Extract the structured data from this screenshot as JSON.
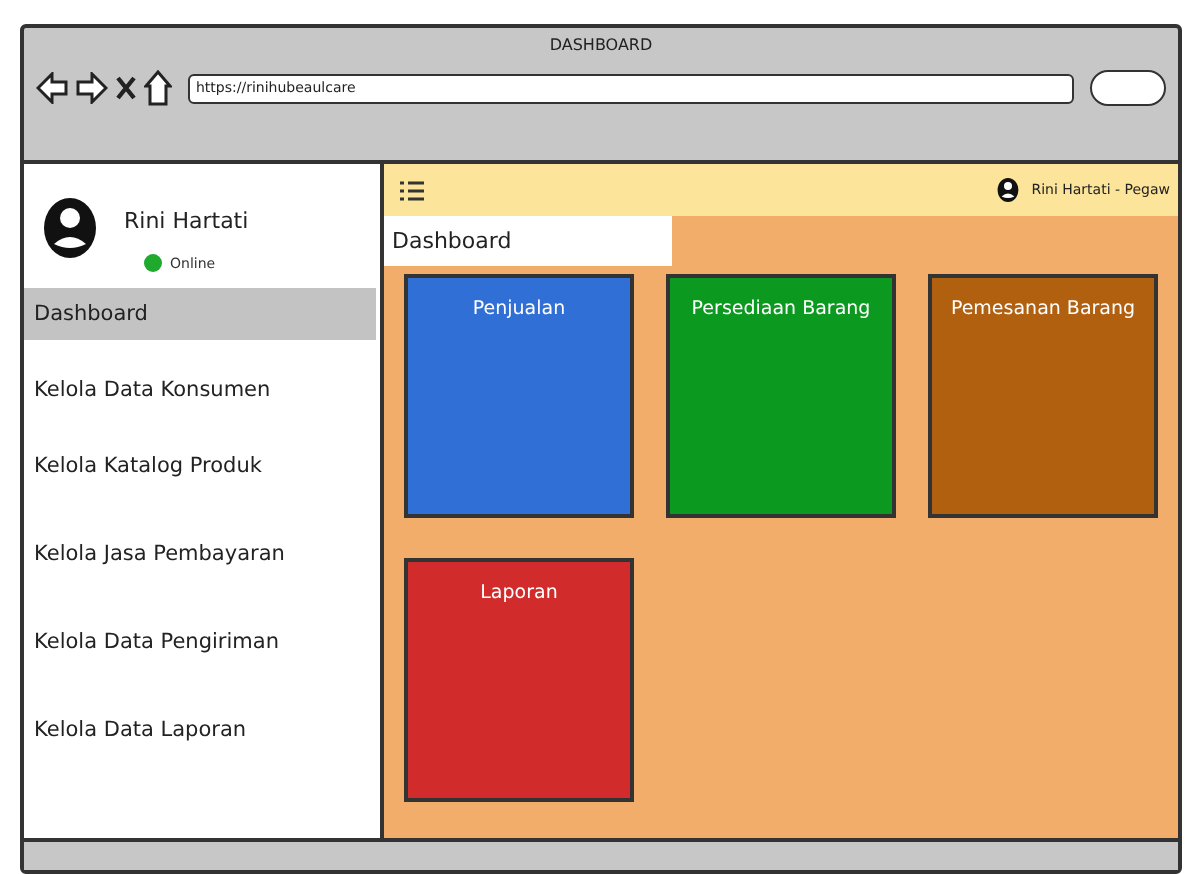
{
  "window": {
    "title": "DASHBOARD"
  },
  "browser": {
    "url": "https://rinihubeaulcare"
  },
  "sidebar": {
    "user": "Rini Hartati",
    "status": "Online",
    "items": [
      {
        "label": "Dashboard",
        "selected": true
      },
      {
        "label": "Kelola Data Konsumen",
        "selected": false
      },
      {
        "label": "Kelola Katalog Produk",
        "selected": false
      },
      {
        "label": "Kelola Jasa Pembayaran",
        "selected": false
      },
      {
        "label": "Kelola Data Pengiriman",
        "selected": false
      },
      {
        "label": "Kelola Data Laporan",
        "selected": false
      }
    ]
  },
  "header": {
    "user": "Rini Hartati - Pegaw"
  },
  "page_title": "Dashboard",
  "tiles": [
    {
      "label": "Penjualan",
      "color": "#2f6fd6"
    },
    {
      "label": "Persediaan Barang",
      "color": "#0b9a1f"
    },
    {
      "label": "Pemesanan Barang",
      "color": "#b0600f"
    },
    {
      "label": "Laporan",
      "color": "#d12b2b"
    }
  ]
}
